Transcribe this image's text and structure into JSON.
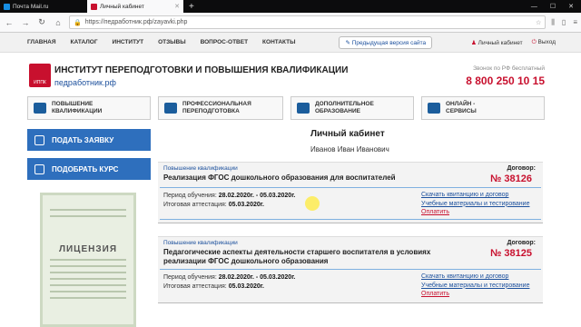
{
  "browser": {
    "tabs": [
      {
        "label": "Почта Mail.ru",
        "active": false
      },
      {
        "label": "Личный кабинет",
        "active": true
      }
    ],
    "url": "https://педработник.рф/zayavki.php"
  },
  "nav": {
    "items": [
      "ГЛАВНАЯ",
      "КАТАЛОГ",
      "ИНСТИТУТ",
      "ОТЗЫВЫ",
      "ВОПРОС-ОТВЕТ",
      "КОНТАКТЫ"
    ],
    "prev_version": "Предыдущая версия сайта",
    "cabinet": "Личный кабинет",
    "exit": "Выход"
  },
  "header": {
    "logo_text": "ИППК",
    "name": "ИНСТИТУТ ПЕРЕПОДГОТОВКИ И ПОВЫШЕНИЯ КВАЛИФИКАЦИИ",
    "site": "педработник.рф",
    "phone_note": "Звонок по РФ бесплатный",
    "phone": "8 800 250 10 15"
  },
  "categories": [
    {
      "line1": "ПОВЫШЕНИЕ",
      "line2": "КВАЛИФИКАЦИИ"
    },
    {
      "line1": "ПРОФЕССИОНАЛЬНАЯ",
      "line2": "ПЕРЕПОДГОТОВКА"
    },
    {
      "line1": "ДОПОЛНИТЕЛЬНОЕ",
      "line2": "ОБРАЗОВАНИЕ"
    },
    {
      "line1": "ОНЛАЙН -",
      "line2": "СЕРВИСЫ"
    }
  ],
  "sidebar": {
    "submit": "ПОДАТЬ ЗАЯВКУ",
    "choose": "ПОДОБРАТЬ КУРС",
    "license_title": "ЛИЦЕНЗИЯ"
  },
  "main": {
    "title": "Личный кабинет",
    "user": "Иванов Иван Иванович",
    "contract_label": "Договор:",
    "period_label": "Период обучения:",
    "exam_label": "Итоговая аттестация:",
    "links": {
      "receipt": "Скачать квитанцию и договор",
      "materials": "Учебные материалы и тестирование",
      "pay": "Оплатить"
    },
    "orders": [
      {
        "category": "Повышение квалификации",
        "name": "Реализация ФГОС дошкольного образования для воспитателей",
        "contract": "№ 38126",
        "period": "28.02.2020г. - 05.03.2020г.",
        "exam": "05.03.2020г."
      },
      {
        "category": "Повышение квалификации",
        "name": "Педагогические аспекты деятельности старшего воспитателя в условиях реализации ФГОС дошкольного образования",
        "contract": "№ 38125",
        "period": "28.02.2020г. - 05.03.2020г.",
        "exam": "05.03.2020г."
      }
    ]
  }
}
